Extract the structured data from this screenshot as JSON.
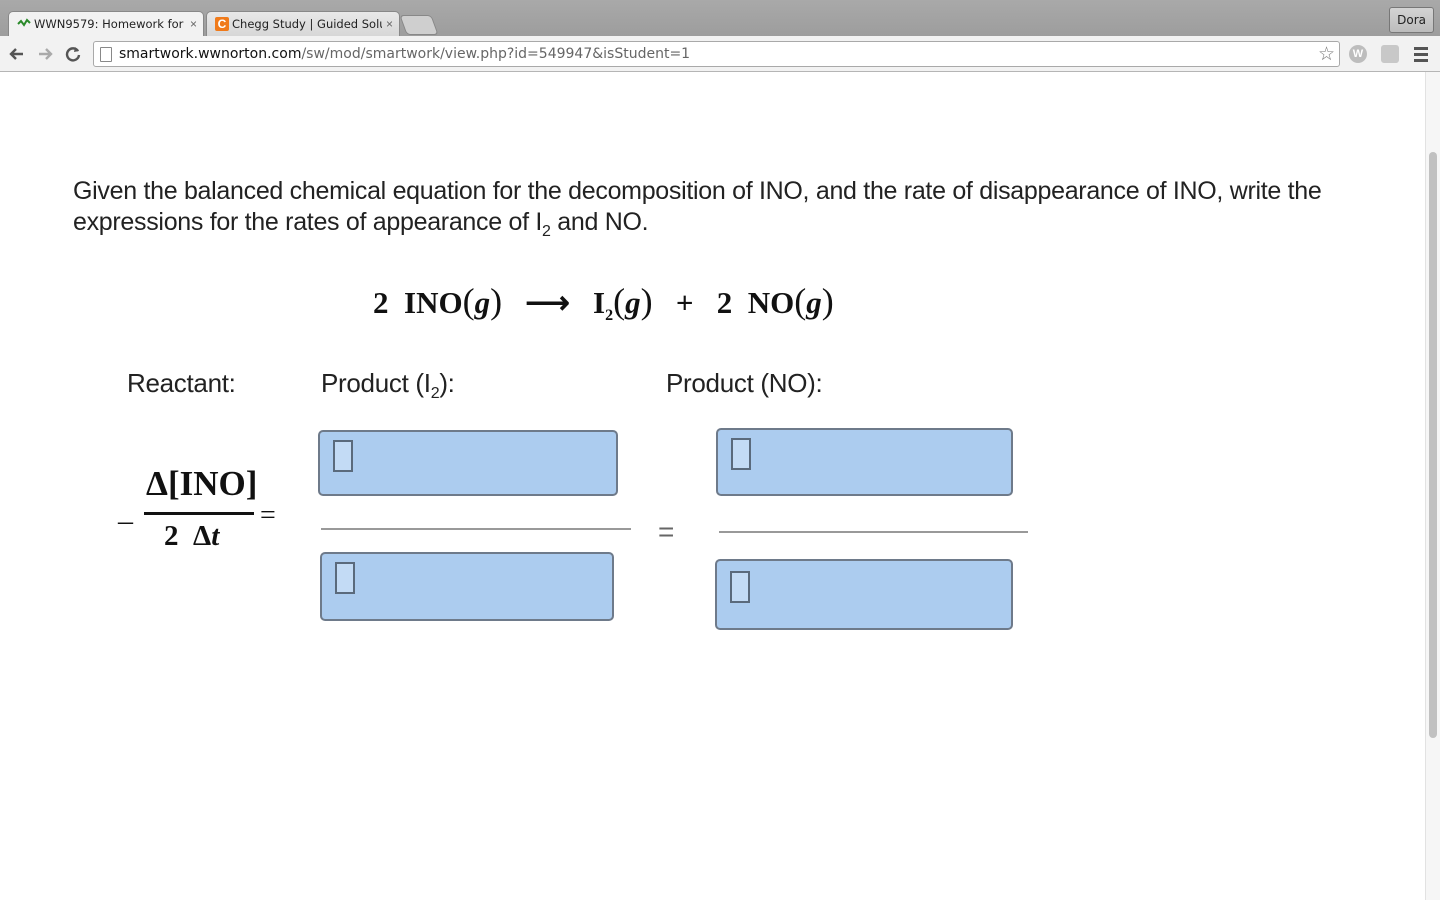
{
  "browser": {
    "tabs": [
      {
        "title": "WWN9579: Homework for",
        "close": "×",
        "active": true
      },
      {
        "title": "Chegg Study | Guided Solu",
        "close": "×",
        "active": false
      }
    ],
    "user": "Dora",
    "url_host": "smartwork.wwnorton.com",
    "url_path": "/sw/mod/smartwork/view.php?id=549947&isStudent=1",
    "extension_label": "W"
  },
  "question": {
    "text_part1": "Given the balanced chemical equation for the decomposition of INO, and the rate of disappearance of INO, write the expressions for the rates of appearance of I",
    "sub": "2",
    "text_part2": " and NO."
  },
  "equation": {
    "coef1": "2",
    "reactant": "INO",
    "state": "g",
    "arrow": "⟶",
    "product1": "I",
    "product1_sub": "2",
    "plus": "+",
    "coef2": "2",
    "product2": "NO"
  },
  "labels": {
    "reactant": "Reactant:",
    "product_i2_prefix": "Product (I",
    "product_i2_sub": "2",
    "product_i2_suffix": "):",
    "product_no": "Product (NO):"
  },
  "reactant_rate": {
    "minus": "–",
    "numerator": "Δ[INO]",
    "denominator_coef": "2",
    "denominator_delta": "Δ",
    "denominator_t": "t",
    "equals": "="
  },
  "equals_between": "=",
  "answer_boxes": {
    "i2_numerator": "",
    "i2_denominator": "",
    "no_numerator": "",
    "no_denominator": ""
  }
}
